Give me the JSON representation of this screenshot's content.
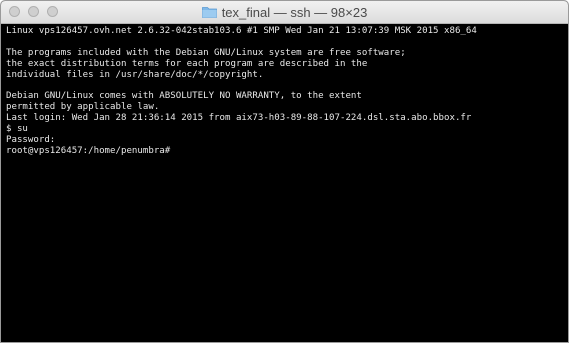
{
  "window": {
    "title": "tex_final — ssh — 98×23",
    "icon": "folder-icon",
    "controls": [
      "close-button",
      "minimize-button",
      "zoom-button"
    ]
  },
  "terminal": {
    "background": "#000000",
    "foreground": "#e8e8e8",
    "lines": [
      "Linux vps126457.ovh.net 2.6.32-042stab103.6 #1 SMP Wed Jan 21 13:07:39 MSK 2015 x86_64",
      "",
      "The programs included with the Debian GNU/Linux system are free software;",
      "the exact distribution terms for each program are described in the",
      "individual files in /usr/share/doc/*/copyright.",
      "",
      "Debian GNU/Linux comes with ABSOLUTELY NO WARRANTY, to the extent",
      "permitted by applicable law.",
      "Last login: Wed Jan 28 21:36:14 2015 from aix73-h03-89-88-107-224.dsl.sta.abo.bbox.fr",
      "$ su",
      "Password:",
      "root@vps126457:/home/penumbra#"
    ]
  }
}
